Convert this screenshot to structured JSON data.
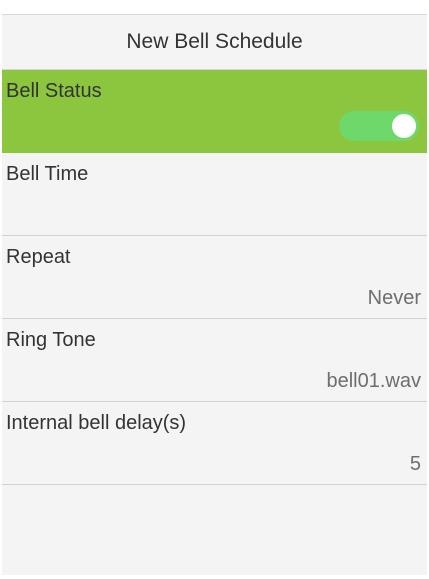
{
  "header": {
    "title": "New Bell Schedule"
  },
  "items": [
    {
      "label": "Bell Status",
      "value": "",
      "toggle": true
    },
    {
      "label": "Bell Time",
      "value": ""
    },
    {
      "label": "Repeat",
      "value": "Never"
    },
    {
      "label": "Ring Tone",
      "value": "bell01.wav"
    },
    {
      "label": "Internal bell delay(s)",
      "value": "5"
    }
  ],
  "colors": {
    "selected_background": "#8cc63f",
    "toggle_on": "#6fd86b"
  }
}
